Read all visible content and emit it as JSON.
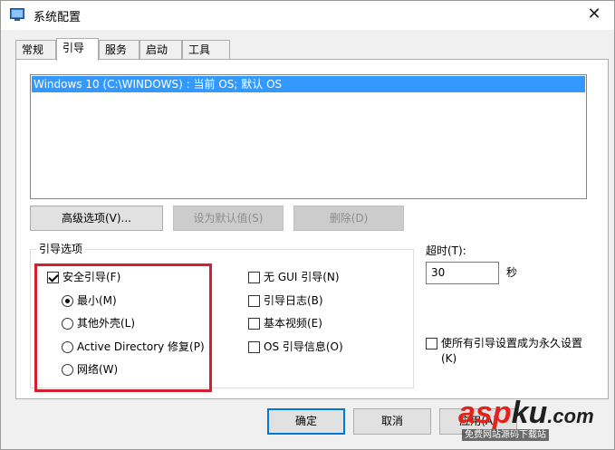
{
  "window": {
    "title": "系统配置",
    "close_glyph": "✕",
    "icon": "system-config-icon"
  },
  "tabs": [
    {
      "label": "常规"
    },
    {
      "label": "引导",
      "active": true
    },
    {
      "label": "服务"
    },
    {
      "label": "启动"
    },
    {
      "label": "工具"
    }
  ],
  "boot_list": {
    "entries": [
      "Windows 10 (C:\\WINDOWS) : 当前 OS; 默认 OS"
    ]
  },
  "buttons": {
    "advanced": "高级选项(V)...",
    "set_default": "设为默认值(S)",
    "delete": "删除(D)"
  },
  "boot_options": {
    "legend": "引导选项",
    "safe_boot": {
      "label": "安全引导(F)",
      "checked": true
    },
    "radios": [
      {
        "label": "最小(M)",
        "checked": true
      },
      {
        "label": "其他外壳(L)",
        "checked": false
      },
      {
        "label": "Active Directory 修复(P)",
        "checked": false
      },
      {
        "label": "网络(W)",
        "checked": false
      }
    ],
    "right_checks": [
      {
        "label": "无 GUI 引导(N)",
        "checked": false
      },
      {
        "label": "引导日志(B)",
        "checked": false
      },
      {
        "label": "基本视频(E)",
        "checked": false
      },
      {
        "label": "OS 引导信息(O)",
        "checked": false
      }
    ]
  },
  "timeout": {
    "label": "超时(T):",
    "value": "30",
    "unit": "秒"
  },
  "permanent": {
    "line1": "使所有引导设置成为永久设置",
    "line2": "(K)",
    "checked": false
  },
  "footer": {
    "ok": "确定",
    "cancel": "取消",
    "apply": "应用(A)"
  },
  "watermark": {
    "logo_a": "asp",
    "logo_b": "ku",
    "logo_c": ".com",
    "sub": "免费网站源码下载站"
  },
  "colors": {
    "selection": "#3399ff",
    "highlight_border": "#d3202d",
    "accent": "#0078d7"
  }
}
